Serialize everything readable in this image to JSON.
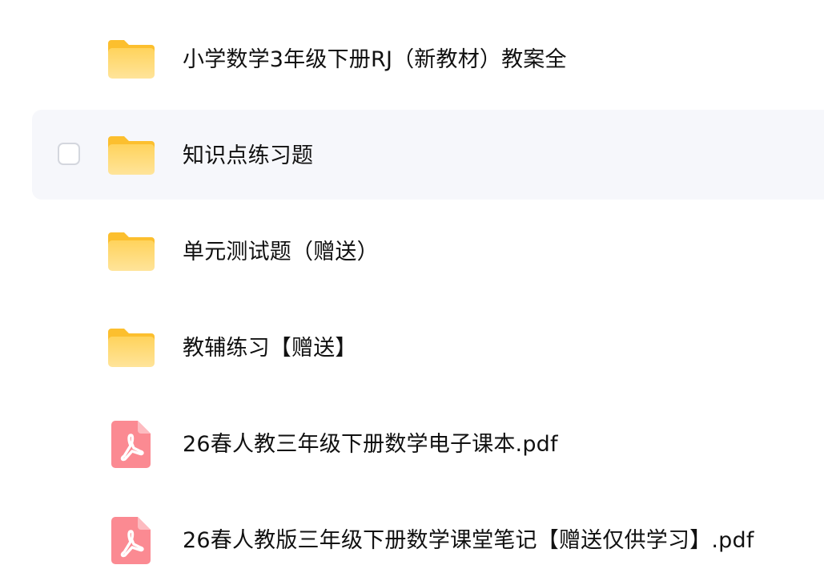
{
  "files": [
    {
      "name": "小学数学3年级下册RJ（新教材）教案全",
      "type": "folder",
      "icon": "folder-icon"
    },
    {
      "name": "知识点练习题",
      "type": "folder",
      "icon": "folder-icon"
    },
    {
      "name": "单元测试题（赠送）",
      "type": "folder",
      "icon": "folder-icon"
    },
    {
      "name": "教辅练习【赠送】",
      "type": "folder",
      "icon": "folder-icon"
    },
    {
      "name": "26春人教三年级下册数学电子课本.pdf",
      "type": "pdf",
      "icon": "pdf-icon"
    },
    {
      "name": "26春人教版三年级下册数学课堂笔记【赠送仅供学习】.pdf",
      "type": "pdf",
      "icon": "pdf-icon"
    }
  ],
  "colors": {
    "folder_top": "#fcc63a",
    "folder_body": "#ffd86a",
    "pdf": "#fb8a92",
    "hover_row": "#f6f7fb"
  }
}
